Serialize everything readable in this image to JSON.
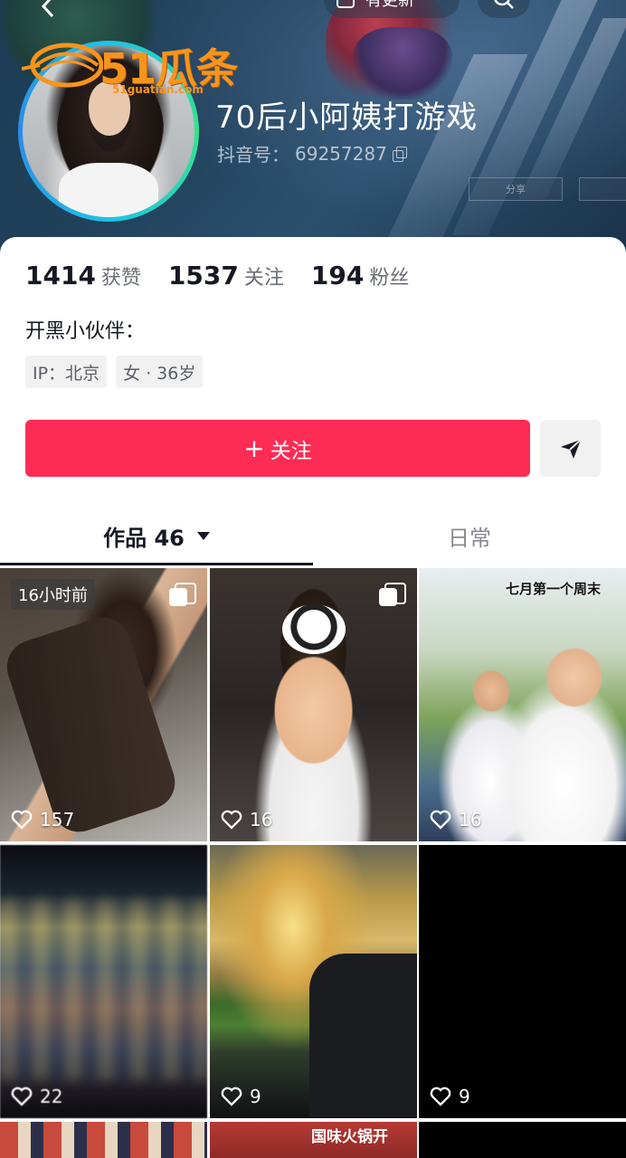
{
  "header": {
    "update_pill_label": "有更新",
    "watermark_brand": "51瓜条",
    "watermark_domain": "51guatian.com",
    "share_tag_label": "分享"
  },
  "profile": {
    "nickname": "70后小阿姨打游戏",
    "douyin_id_label": "抖音号：",
    "douyin_id_value": "69257287",
    "bio": "开黑小伙伴：",
    "tags": [
      "IP：北京",
      "女 · 36岁"
    ]
  },
  "stats": [
    {
      "value": "1414",
      "label": "获赞"
    },
    {
      "value": "1537",
      "label": "关注"
    },
    {
      "value": "194",
      "label": "粉丝"
    }
  ],
  "actions": {
    "follow_label": "关注"
  },
  "tabs": {
    "works_label": "作品 46",
    "daily_label": "日常"
  },
  "videos": [
    {
      "likes": "157",
      "badge": "16小时前",
      "multi": true,
      "theme": "hands"
    },
    {
      "likes": "16",
      "multi": true,
      "theme": "kid"
    },
    {
      "likes": "16",
      "caption": "七月第一个周末",
      "theme": "family"
    },
    {
      "likes": "22",
      "theme": "blur"
    },
    {
      "likes": "9",
      "theme": "sunset"
    },
    {
      "likes": "9",
      "theme": "black"
    },
    {
      "theme": "stage"
    },
    {
      "caption": "国味火锅开",
      "theme": "hotpot"
    },
    {
      "theme": "black"
    }
  ],
  "colors": {
    "accent": "#fe2c55",
    "text_primary": "#161823",
    "text_secondary": "#6b6d75",
    "tag_bg": "#f1f1f2"
  }
}
